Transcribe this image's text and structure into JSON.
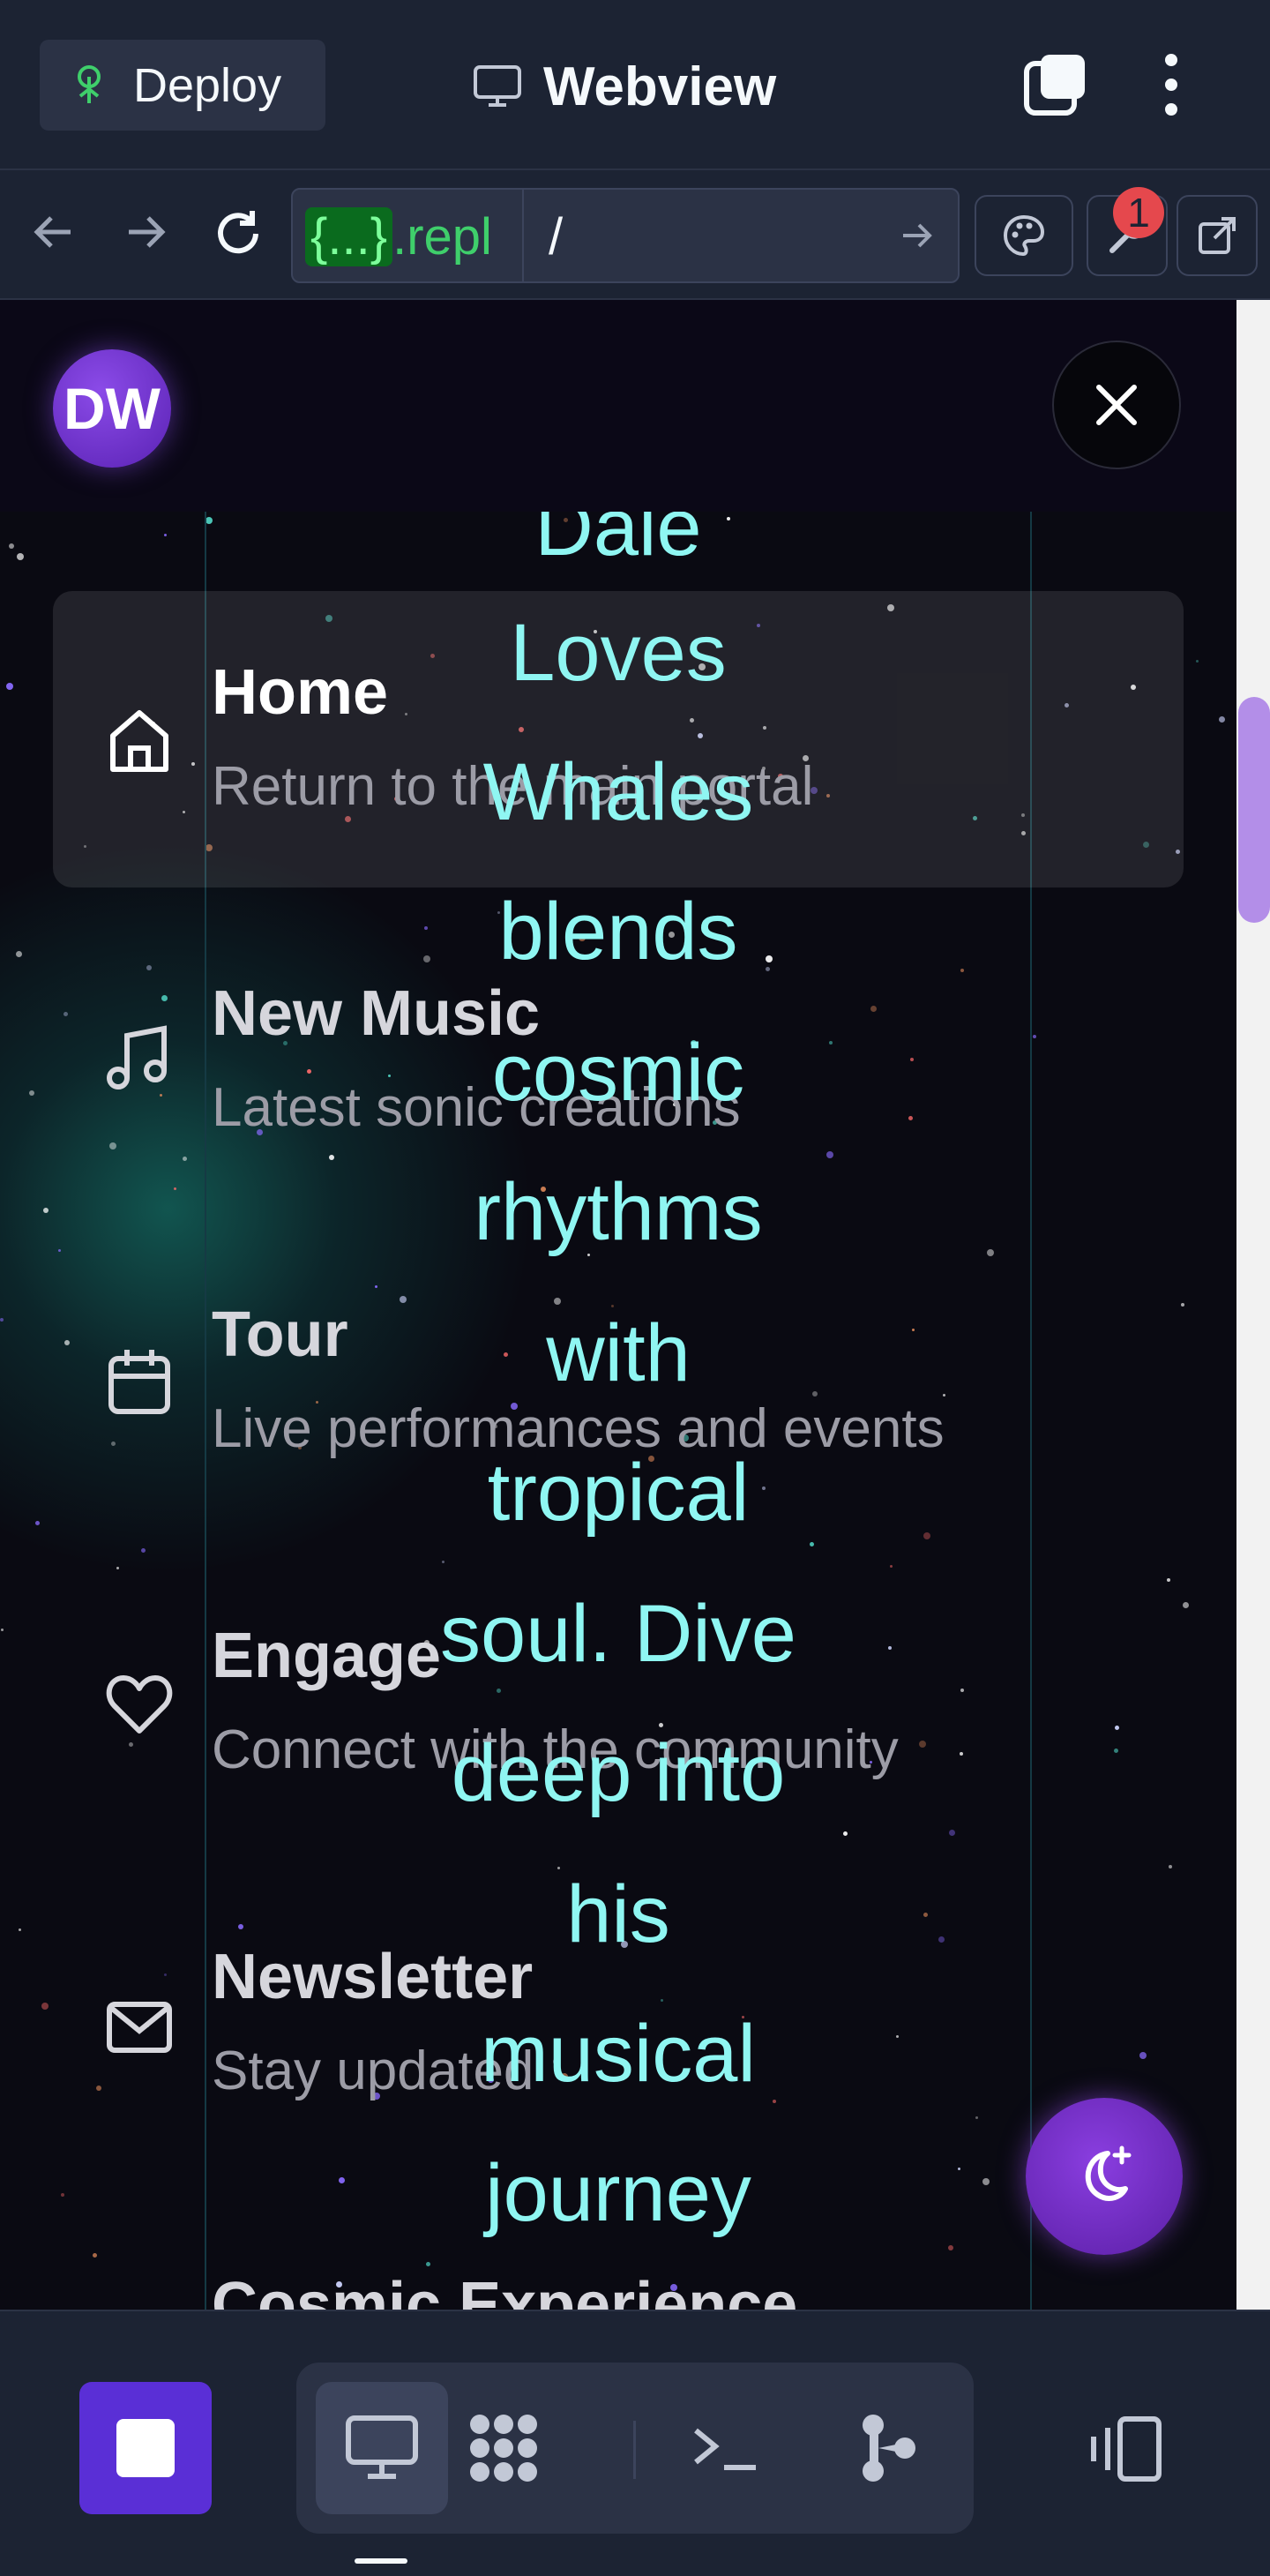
{
  "topbar": {
    "deploy_label": "Deploy",
    "title": "Webview",
    "icons": [
      "deploy-icon",
      "monitor-icon",
      "tabs-icon",
      "more-vertical-icon"
    ]
  },
  "urlbar": {
    "url_prefix_braces": "{...}",
    "url_prefix_domain": ".repl",
    "url_path": "/",
    "badge_count": "1",
    "icons": [
      "back-arrow-icon",
      "forward-arrow-icon",
      "reload-icon",
      "go-arrow-icon",
      "palette-icon",
      "wrench-icon",
      "external-link-icon"
    ]
  },
  "webview": {
    "avatar_initials": "DW",
    "nav": [
      {
        "title": "Home",
        "subtitle": "Return to the main portal",
        "icon": "home-icon",
        "active": true
      },
      {
        "title": "New Music",
        "subtitle": "Latest sonic creations",
        "icon": "music-icon"
      },
      {
        "title": "Tour",
        "subtitle": "Live performances and events",
        "icon": "calendar-icon"
      },
      {
        "title": "Engage",
        "subtitle": "Connect with the community",
        "icon": "heart-icon"
      },
      {
        "title": "Newsletter",
        "subtitle": "Stay updated",
        "icon": "mail-icon"
      },
      {
        "title": "Cosmic Experience"
      }
    ],
    "lyrics": [
      "Dale",
      "Loves",
      "Whales",
      "blends",
      "cosmic",
      "rhythms",
      "with",
      "tropical",
      "soul. Dive",
      "deep into",
      "his",
      "musical",
      "journey"
    ],
    "colors": {
      "lyric": "#8ff6f2",
      "accent": "#7b35d6",
      "background": "#0a0a12"
    }
  },
  "bottombar": {
    "icons": [
      "stop-icon",
      "monitor-icon",
      "apps-grid-icon",
      "terminal-icon",
      "git-icon",
      "device-preview-icon"
    ]
  }
}
